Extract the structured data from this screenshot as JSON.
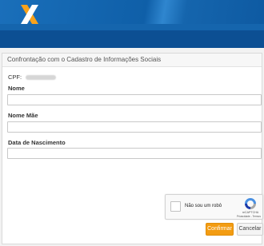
{
  "panel": {
    "title": "Confrontação com o Cadastro de Informações Sociais"
  },
  "cpf": {
    "label": "CPF:"
  },
  "fields": [
    {
      "label": "Nome",
      "value": ""
    },
    {
      "label": "Nome Mãe",
      "value": ""
    },
    {
      "label": "Data de Nascimento",
      "value": ""
    }
  ],
  "captcha": {
    "label": "Não sou um robô",
    "brand": "reCAPTCHA",
    "links": "Privacidade - Termos"
  },
  "buttons": {
    "confirm": "Confirmar",
    "cancel": "Cancelar"
  },
  "colors": {
    "header": "#1565ad",
    "subbar": "#0c4f93",
    "confirm": "#f39c12"
  },
  "icons": {
    "logo": "caixa-x-logo",
    "captcha": "recaptcha-icon"
  }
}
